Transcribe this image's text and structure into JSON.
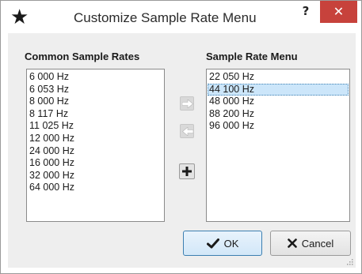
{
  "window": {
    "title": "Customize Sample Rate Menu",
    "app_icon": "star-icon",
    "help_label": "?",
    "close_label": "✕"
  },
  "common": {
    "heading": "Common Sample Rates",
    "items": [
      "6 000 Hz",
      "6 053 Hz",
      "8 000 Hz",
      "8 117 Hz",
      "11 025 Hz",
      "12 000 Hz",
      "24 000 Hz",
      "16 000 Hz",
      "32 000 Hz",
      "64 000 Hz"
    ]
  },
  "menu": {
    "heading": "Sample Rate Menu",
    "items": [
      "22 050 Hz",
      "44 100 Hz",
      "48 000 Hz",
      "88 200 Hz",
      "96 000 Hz"
    ],
    "selected": "44 100 Hz"
  },
  "buttons": {
    "add_icon": "arrow-right-icon",
    "remove_icon": "arrow-left-icon",
    "custom_icon": "plus-icon",
    "ok_label": "OK",
    "ok_icon": "checkmark-icon",
    "cancel_label": "Cancel",
    "cancel_icon": "x-icon"
  },
  "colors": {
    "close_button": "#c7423c",
    "selection": "#cce6fa",
    "default_button_border": "#3c7fb1"
  }
}
